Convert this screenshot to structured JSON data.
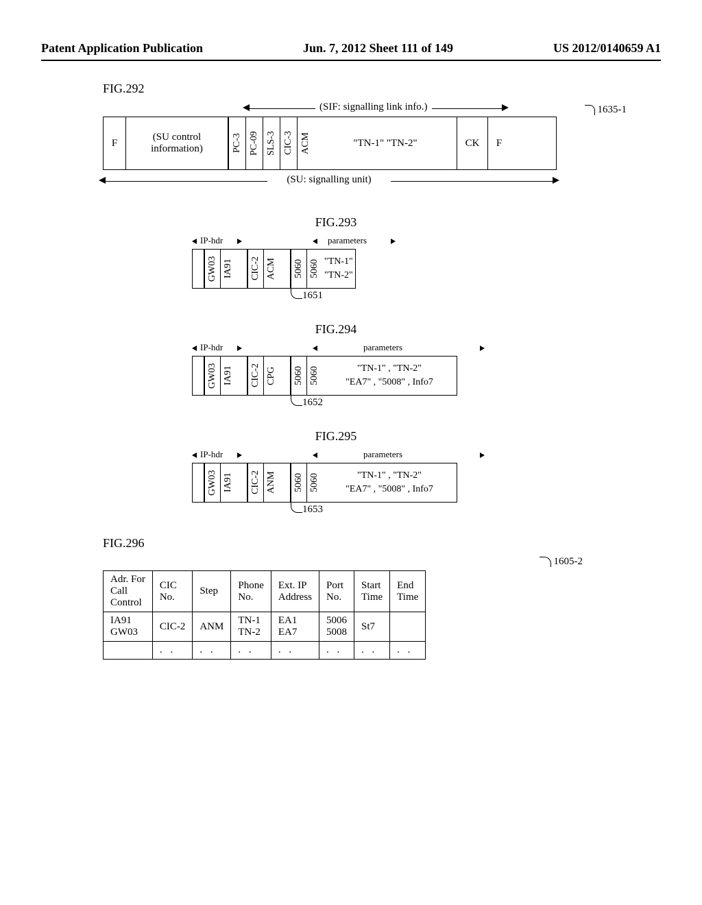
{
  "header": {
    "left": "Patent Application Publication",
    "center": "Jun. 7, 2012  Sheet 111 of 149",
    "right": "US 2012/0140659 A1"
  },
  "fig292": {
    "label": "FIG.292",
    "sif_label": "(SIF: signalling link info.)",
    "ref": "1635-1",
    "cells": {
      "f1": "F",
      "su_ctrl": "(SU control\ninformation)",
      "pc3": "PC-3",
      "pc09": "PC-09",
      "sls3": "SLS-3",
      "cic3": "CIC-3",
      "acm": "ACM",
      "tn": "\"TN-1\"    \"TN-2\"",
      "ck": "CK",
      "f2": "F"
    },
    "su_label": "(SU: signalling unit)"
  },
  "fig293": {
    "label": "FIG.293",
    "ip_hdr": "IP-hdr",
    "params_label": "parameters",
    "ref": "1651",
    "cells": {
      "gw03": "GW03",
      "ia91": "IA91",
      "cic2": "CIC-2",
      "acm": "ACM",
      "p1": "5060",
      "p2": "5060",
      "tn": "\"TN-1\"\n\"TN-2\""
    }
  },
  "fig294": {
    "label": "FIG.294",
    "ip_hdr": "IP-hdr",
    "params_label": "parameters",
    "ref": "1652",
    "cells": {
      "gw03": "GW03",
      "ia91": "IA91",
      "cic2": "CIC-2",
      "cpg": "CPG",
      "p1": "5060",
      "p2": "5060",
      "param": "\"TN-1\" , \"TN-2\"\n\"EA7\" , \"5008\" , Info7"
    }
  },
  "fig295": {
    "label": "FIG.295",
    "ip_hdr": "IP-hdr",
    "params_label": "parameters",
    "ref": "1653",
    "cells": {
      "gw03": "GW03",
      "ia91": "IA91",
      "cic2": "CIC-2",
      "anm": "ANM",
      "p1": "5060",
      "p2": "5060",
      "param": "\"TN-1\" , \"TN-2\"\n\"EA7\" , \"5008\" , Info7"
    }
  },
  "fig296": {
    "label": "FIG.296",
    "ref": "1605-2",
    "headers": {
      "adr": "Adr. For\nCall\nControl",
      "cic": "CIC\nNo.",
      "step": "Step",
      "phone": "Phone\nNo.",
      "extip": "Ext. IP\nAddress",
      "port": "Port\nNo.",
      "start": "Start\nTime",
      "end": "End\nTime"
    },
    "row1": {
      "adr": "IA91\nGW03",
      "cic": "CIC-2",
      "step": "ANM",
      "phone": "TN-1\nTN-2",
      "extip": "EA1\nEA7",
      "port": "5006\n5008",
      "start": "St7",
      "end": ""
    },
    "dots": ". ."
  }
}
